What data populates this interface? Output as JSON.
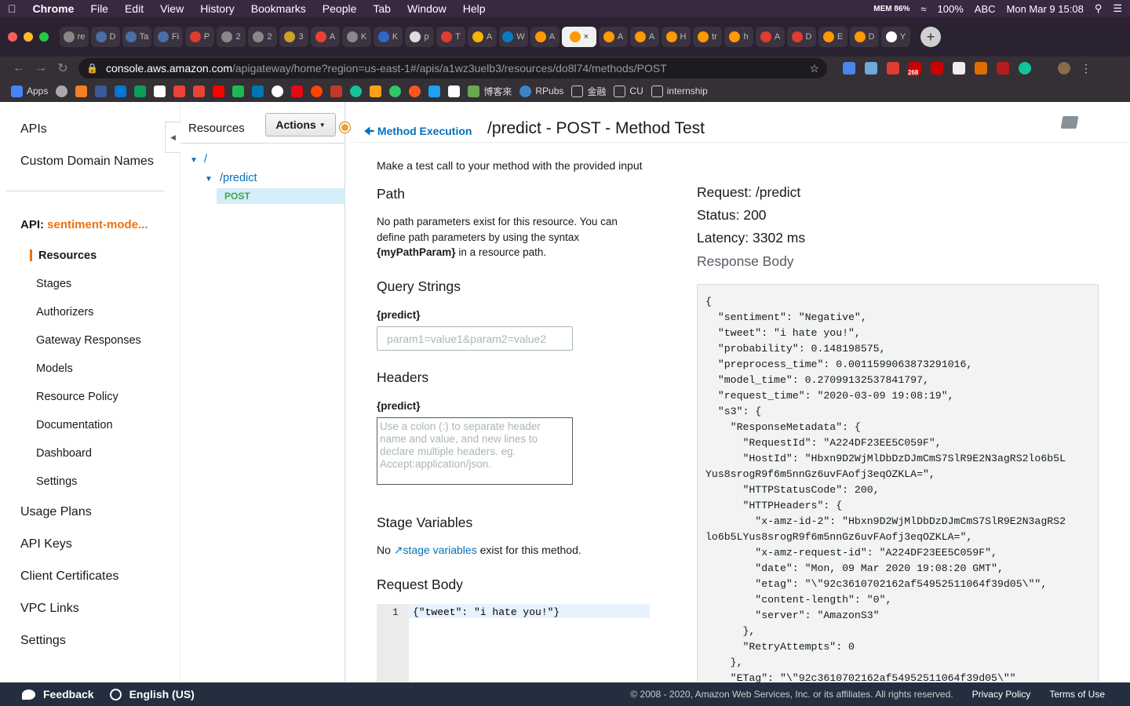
{
  "menubar": {
    "apple": "",
    "items": [
      "Chrome",
      "File",
      "Edit",
      "View",
      "History",
      "Bookmarks",
      "People",
      "Tab",
      "Window",
      "Help"
    ],
    "status": {
      "mem": "MEM 86%",
      "battery": "100%",
      "input": "ABC",
      "clock": "Mon Mar 9  15:08"
    }
  },
  "tabs": [
    {
      "letter": "re"
    },
    {
      "letter": "D"
    },
    {
      "letter": "Ta"
    },
    {
      "letter": "Fi"
    },
    {
      "letter": "P"
    },
    {
      "letter": "2"
    },
    {
      "letter": "2"
    },
    {
      "letter": "3"
    },
    {
      "letter": "A"
    },
    {
      "letter": "K"
    },
    {
      "letter": "K"
    },
    {
      "letter": "p"
    },
    {
      "letter": "T"
    },
    {
      "letter": "A"
    },
    {
      "letter": "W"
    },
    {
      "letter": "A"
    },
    {
      "letter": "×"
    },
    {
      "letter": "A"
    },
    {
      "letter": "A"
    },
    {
      "letter": "H"
    },
    {
      "letter": "tr"
    },
    {
      "letter": "h"
    },
    {
      "letter": "A"
    },
    {
      "letter": "D"
    },
    {
      "letter": "E"
    },
    {
      "letter": "D"
    },
    {
      "letter": "Y"
    }
  ],
  "address": {
    "host": "console.aws.amazon.com",
    "path": "/apigateway/home?region=us-east-1#/apis/a1wz3uelb3/resources/do8l74/methods/POST",
    "badge": "268"
  },
  "bookmarks": [
    "Apps",
    "",
    "",
    "",
    "",
    "",
    "",
    "",
    "",
    "",
    "",
    "",
    "",
    "",
    "",
    "",
    "",
    "",
    "",
    "",
    "",
    "",
    "",
    "",
    "博客來",
    "RPubs",
    "金融",
    "CU",
    "internship"
  ],
  "left_nav": {
    "apis": "APIs",
    "custom_domain": "Custom Domain Names",
    "api_prefix": "API:",
    "api_name": "sentiment-mode...",
    "sub_items": [
      "Resources",
      "Stages",
      "Authorizers",
      "Gateway Responses",
      "Models",
      "Resource Policy",
      "Documentation",
      "Dashboard",
      "Settings"
    ],
    "bottom_items": [
      "Usage Plans",
      "API Keys",
      "Client Certificates",
      "VPC Links",
      "Settings"
    ]
  },
  "resources": {
    "title": "Resources",
    "actions": "Actions",
    "root": "/",
    "child": "/predict",
    "method": "POST"
  },
  "main": {
    "back": "Method Execution",
    "title": "/predict - POST - Method Test",
    "intro": "Make a test call to your method with the provided input",
    "path_h": "Path",
    "path_text_1": "No path parameters exist for this resource. You can",
    "path_text_2": "define path parameters by using the syntax",
    "path_text_3_bold": "{myPathParam}",
    "path_text_3": " in a resource path.",
    "qs_h": "Query Strings",
    "qs_label": "{predict}",
    "qs_placeholder": "param1=value1&param2=value2",
    "headers_h": "Headers",
    "headers_label": "{predict}",
    "headers_placeholder": "Use a colon (:) to separate header\nname and value, and new lines to\ndeclare multiple headers. eg.\nAccept:application/json.",
    "stage_h": "Stage Variables",
    "stage_pre": "No ",
    "stage_link": "stage variables",
    "stage_post": " exist for this method.",
    "body_h": "Request Body",
    "body_line_no": "1",
    "body_code": "{\"tweet\": \"i hate you!\"}"
  },
  "response": {
    "request": "Request: /predict",
    "status": "Status: 200",
    "latency": "Latency: 3302 ms",
    "body_title": "Response Body",
    "body": "{\n  \"sentiment\": \"Negative\",\n  \"tweet\": \"i hate you!\",\n  \"probability\": 0.148198575,\n  \"preprocess_time\": 0.0011599063873291016,\n  \"model_time\": 0.27099132537841797,\n  \"request_time\": \"2020-03-09 19:08:19\",\n  \"s3\": {\n    \"ResponseMetadata\": {\n      \"RequestId\": \"A224DF23EE5C059F\",\n      \"HostId\": \"Hbxn9D2WjMlDbDzDJmCmS7SlR9E2N3agRS2lo6b5L\nYus8srogR9f6m5nnGz6uvFAofj3eqOZKLA=\",\n      \"HTTPStatusCode\": 200,\n      \"HTTPHeaders\": {\n        \"x-amz-id-2\": \"Hbxn9D2WjMlDbDzDJmCmS7SlR9E2N3agRS2\nlo6b5LYus8srogR9f6m5nnGz6uvFAofj3eqOZKLA=\",\n        \"x-amz-request-id\": \"A224DF23EE5C059F\",\n        \"date\": \"Mon, 09 Mar 2020 19:08:20 GMT\",\n        \"etag\": \"\\\"92c3610702162af54952511064f39d05\\\"\",\n        \"content-length\": \"0\",\n        \"server\": \"AmazonS3\"\n      },\n      \"RetryAttempts\": 0\n    },\n    \"ETag\": \"\\\"92c3610702162af54952511064f39d05\\\"\""
  },
  "footer": {
    "feedback": "Feedback",
    "language": "English (US)",
    "copyright": "© 2008 - 2020, Amazon Web Services, Inc. or its affiliates. All rights reserved.",
    "privacy": "Privacy Policy",
    "terms": "Terms of Use"
  },
  "colors": {
    "accent": "#ec7211",
    "link": "#0073bb",
    "post_green": "#3aab48",
    "footer_bg": "#232f3e"
  }
}
